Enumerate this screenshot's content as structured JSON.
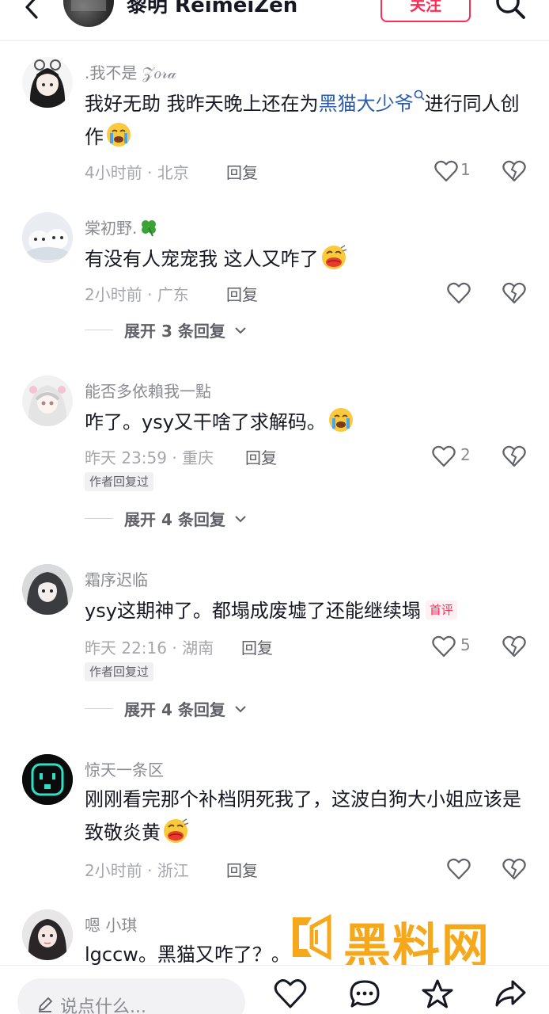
{
  "header": {
    "name": "黎明 ReimeiZen",
    "follow_label": "关注",
    "back_icon": "back-icon",
    "search_icon": "search-icon"
  },
  "comments": [
    {
      "name": ".我不是 𝒵𝑜𝓇𝒶",
      "body_pre": "我好无助 我昨天晚上还在为",
      "body_link": "黑猫大少爷",
      "body_post": "进行同人创作",
      "emoji": "loudly-crying-emoji",
      "time_location": "4小时前 · 北京",
      "reply_label": "回复",
      "likes": "1"
    },
    {
      "name": "棠初野.",
      "name_icon": "four-leaf-clover-icon",
      "body": "有没有人宠宠我 这人又咋了",
      "emoji": "blowing-kiss-emoji",
      "time_location": "2小时前 · 广东",
      "reply_label": "回复",
      "likes": "",
      "expand_label": "展开 3 条回复"
    },
    {
      "name": "能否多依賴我一點",
      "body": "咋了。ysy又干啥了求解码。",
      "emoji": "loudly-crying-emoji",
      "time_location": "昨天 23:59 · 重庆",
      "reply_label": "回复",
      "likes": "2",
      "author_tag": "作者回复过",
      "expand_label": "展开 4 条回复"
    },
    {
      "name": "霜序迟临",
      "body": "ysy这期神了。都塌成废墟了还能继续塌",
      "badge": "首评",
      "time_location": "昨天 22:16 · 湖南",
      "reply_label": "回复",
      "likes": "5",
      "author_tag": "作者回复过",
      "expand_label": "展开 4 条回复"
    },
    {
      "name": "惊天一条区",
      "body": "刚刚看完那个补档阴死我了，这波白狗大小姐应该是致敬炎黄",
      "emoji": "blowing-kiss-emoji",
      "time_location": "2小时前 · 浙江",
      "reply_label": "回复",
      "likes": ""
    },
    {
      "name": "嗯 小琪",
      "body": "lgccw。黑猫又咋了？。",
      "time_location": "",
      "reply_label": "",
      "likes": ""
    }
  ],
  "bottom": {
    "input_placeholder": "说点什么...",
    "icons": [
      "heart-icon",
      "comment-icon",
      "star-icon",
      "share-icon"
    ]
  },
  "watermark": {
    "title": "黑料网",
    "url": "https://hlwf1.com"
  },
  "colors": {
    "accent": "#fe2c55",
    "link": "#2c5ba8",
    "secondary_text": "#8a8b91",
    "watermark": "#f5a81c"
  }
}
